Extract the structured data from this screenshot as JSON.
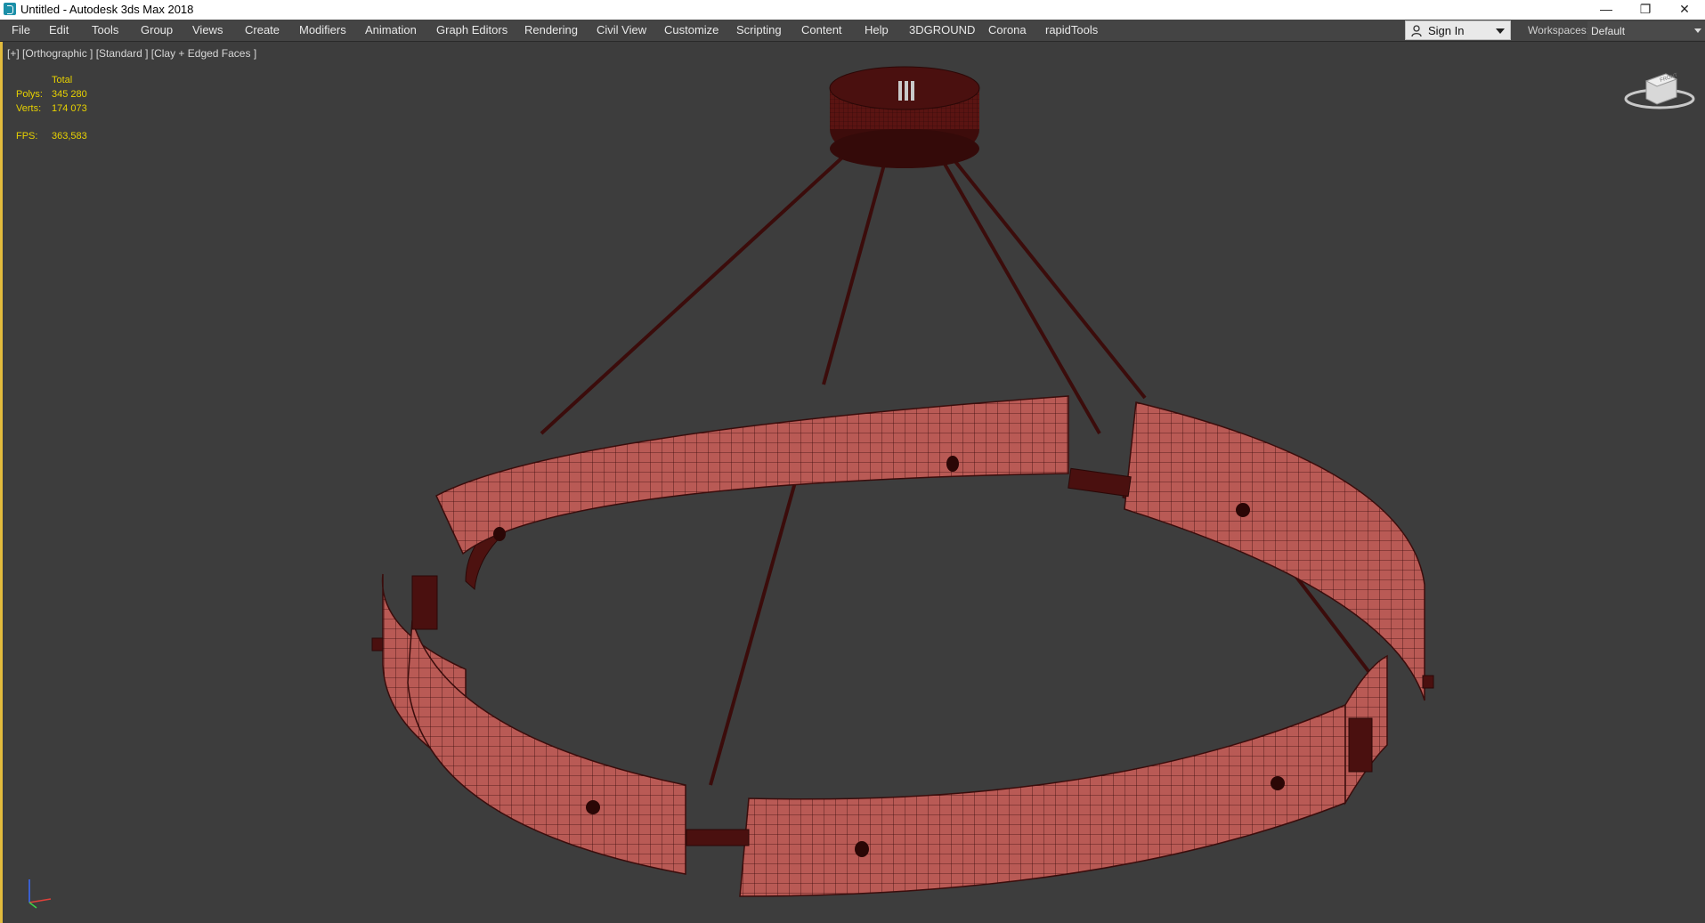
{
  "window": {
    "title": "Untitled - Autodesk 3ds Max 2018",
    "controls": [
      "—",
      "❐",
      "✕"
    ]
  },
  "menu": {
    "items": [
      "File",
      "Edit",
      "Tools",
      "Group",
      "Views",
      "Create",
      "Modifiers",
      "Animation",
      "Graph Editors",
      "Rendering",
      "Civil View",
      "Customize",
      "Scripting",
      "Content",
      "Help",
      "3DGROUND",
      "Corona",
      "rapidTools"
    ],
    "sign_in": "Sign In",
    "workspaces_label": "Workspaces:",
    "workspaces_value": "Default"
  },
  "viewport": {
    "label": "[+] [Orthographic ] [Standard ] [Clay + Edged Faces ]",
    "stats": {
      "header": "Total",
      "polys_label": "Polys:",
      "polys_value": "345 280",
      "verts_label": "Verts:",
      "verts_value": "174 073",
      "fps_label": "FPS:",
      "fps_value": "363,583"
    },
    "viewcube_face": "FRONT"
  },
  "colors": {
    "viewport_bg": "#3d3d3d",
    "mesh_fill": "#b95a55",
    "mesh_wire": "#3a0d0c",
    "stats_text": "#e8d200",
    "active_border": "#e2bb3d"
  }
}
